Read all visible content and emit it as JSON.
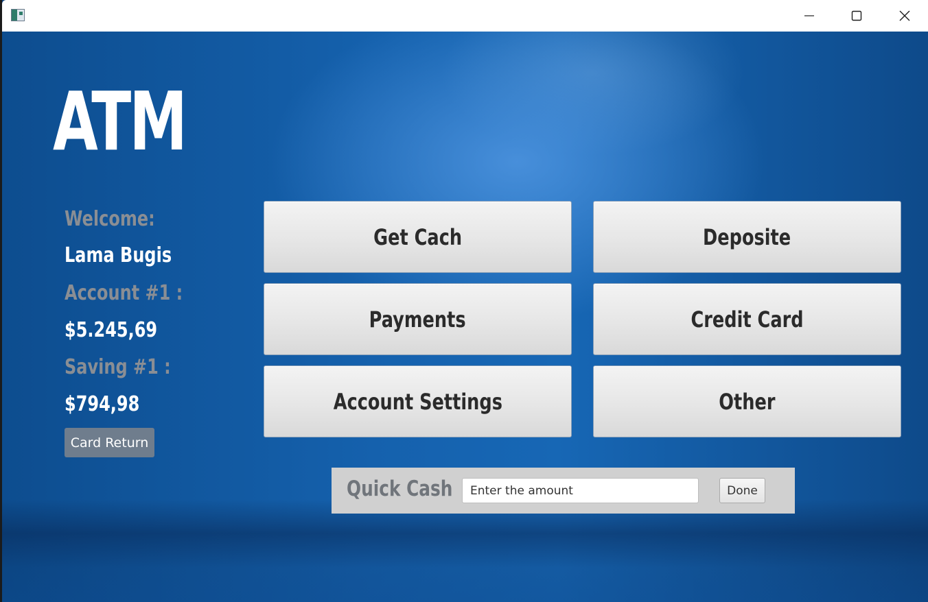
{
  "window": {
    "title": "",
    "controls": {
      "minimize_icon": "minimize-icon",
      "maximize_icon": "maximize-icon",
      "close_icon": "close-icon"
    }
  },
  "header": {
    "title": "ATM"
  },
  "account_info": {
    "welcome_label": "Welcome:",
    "user_name": "Lama Bugis",
    "account_label": "Account #1 :",
    "account_balance": "$5.245,69",
    "saving_label": "Saving #1 :",
    "saving_balance": "$794,98",
    "card_return_label": "Card Return"
  },
  "menu": {
    "buttons": [
      {
        "label": "Get Cach"
      },
      {
        "label": "Deposite"
      },
      {
        "label": "Payments"
      },
      {
        "label": "Credit Card"
      },
      {
        "label": "Account Settings"
      },
      {
        "label": "Other"
      }
    ]
  },
  "quick_cash": {
    "label": "Quick Cash",
    "input_placeholder": "Enter the amount",
    "input_value": "",
    "done_label": "Done"
  },
  "colors": {
    "background_blue": "#1561ad",
    "label_gray": "#8a8e94",
    "value_white": "#ffffff",
    "card_return_bg": "#6f7d8d",
    "quick_bar_bg": "#d0d0d0"
  }
}
